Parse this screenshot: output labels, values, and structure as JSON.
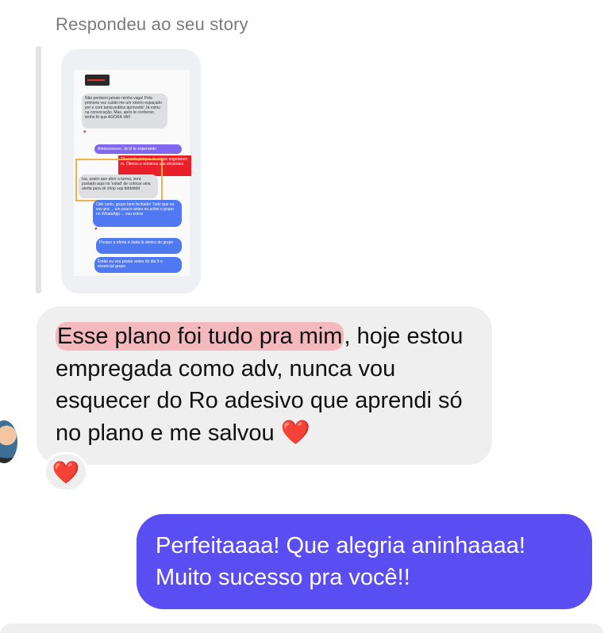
{
  "reply": {
    "header": "Respondeu ao seu story"
  },
  "story": {
    "msg1": "Não perderei jamais minha vaga! Pela primeira vez cuidei me um roteiro espaçado por e com tanta prática aprovado! Já estou na convocação. Mas, após te conhecer, tenho fé que AGORA VAI!",
    "msg2": "Amoooooooo. Já tô te esperando",
    "red_label": "Tô vendo porque as vagas esgotaram rs. Ótimos e mínimos são eficientes",
    "msg3": "Isa, assim que abrir a turma, será postado aqui no 'estad' de colocar uma alerta para ok shop sup bdddddd",
    "msg4": "Oiiiii certo, grupo bem fechado! Tudo que eu vou pra ... um pouco antes eu achei o grupo no WhatsApp ... vou entrar",
    "msg5": "Porque a oferta é dada lá dentro do grupo",
    "msg6": "Então eu vou postar antes do dia 9 e essencial grupo"
  },
  "incoming": {
    "highlighted": "Esse plano foi tudo pra mim",
    "rest": ", hoje estou empregada como adv, nunca vou esquecer do Ro adesivo que aprendi só no plano e me salvou",
    "heart": "❤️"
  },
  "reaction": {
    "emoji": "❤️"
  },
  "outgoing": {
    "line1": "Perfeitaaaa! Que alegria aninhaaaa!",
    "line2": "Muito sucesso pra você!!"
  },
  "colors": {
    "incoming_bubble": "#efefef",
    "outgoing_bubble": "#5a4df2",
    "highlight": "#f3b9bd",
    "heart": "#e0152d"
  }
}
